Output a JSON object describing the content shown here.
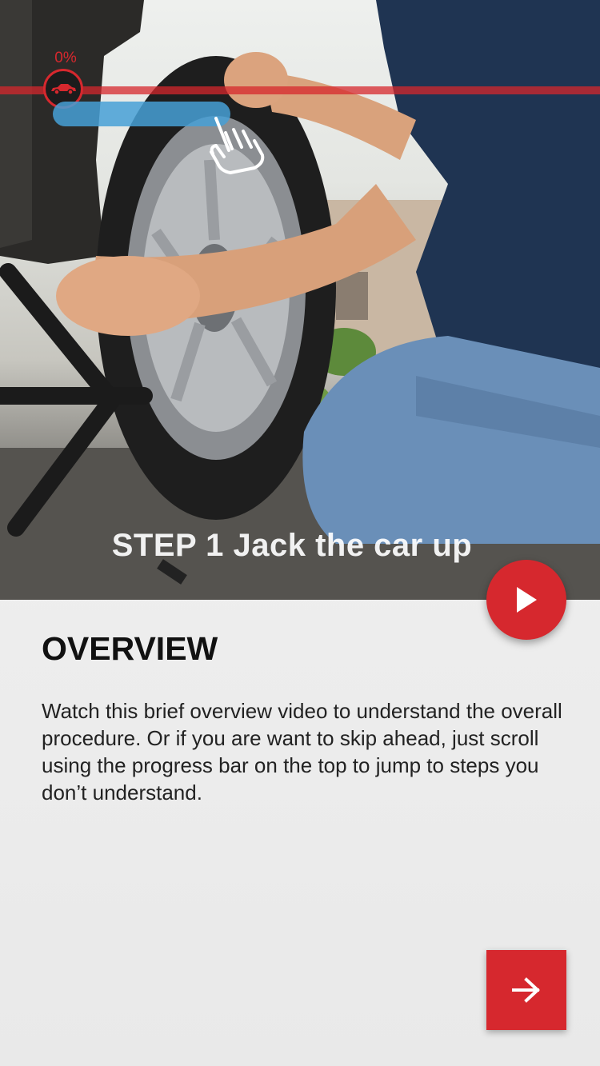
{
  "progress": {
    "percent_label": "0%",
    "value": 0
  },
  "hero": {
    "step_caption": "STEP 1  Jack the car up",
    "play_icon": "play-icon",
    "hand_icon": "hand-swipe-icon",
    "car_icon": "car-icon"
  },
  "overview": {
    "title": "OVERVIEW",
    "body": "Watch this brief overview video to understand the overall procedure. Or if you are want to skip ahead, just scroll using the progress bar on the top to jump to steps you don’t understand."
  },
  "next_button": {
    "icon": "arrow-right-icon"
  },
  "colors": {
    "accent": "#d6282e",
    "hint_blue": "#46a0d6"
  }
}
